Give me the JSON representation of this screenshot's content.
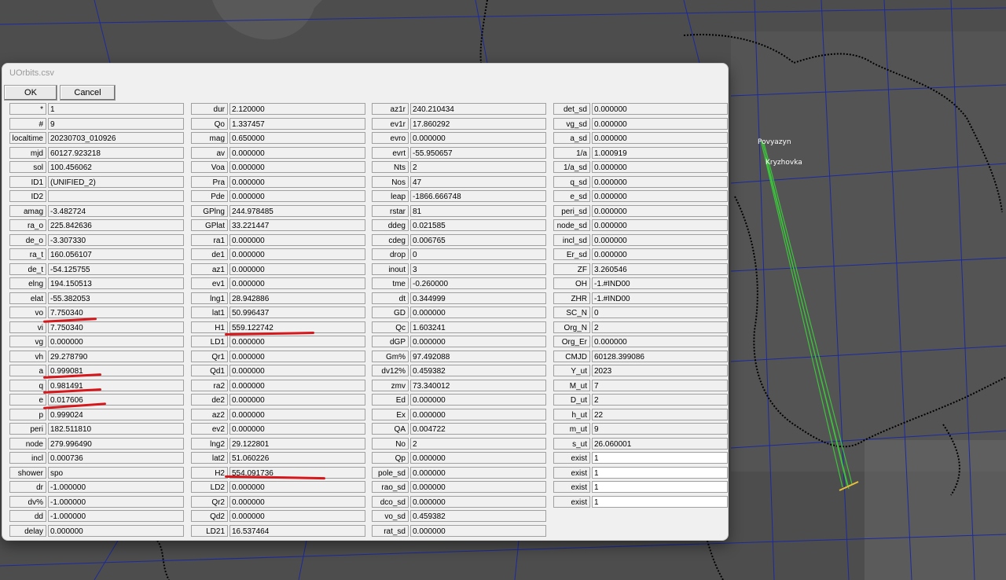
{
  "window": {
    "title": "UOrbits.csv"
  },
  "buttons": {
    "ok": "OK",
    "cancel": "Cancel"
  },
  "map": {
    "stations": [
      {
        "name": "Povyazyn"
      },
      {
        "name": "Kryzhovka"
      }
    ]
  },
  "columns": [
    [
      {
        "label": "*",
        "value": "1"
      },
      {
        "label": "#",
        "value": "9"
      },
      {
        "label": "localtime",
        "value": "20230703_010926"
      },
      {
        "label": "mjd",
        "value": "60127.923218"
      },
      {
        "label": "sol",
        "value": "100.456062"
      },
      {
        "label": "ID1",
        "value": "(UNIFIED_2)"
      },
      {
        "label": "ID2",
        "value": ""
      },
      {
        "label": "amag",
        "value": "-3.482724"
      },
      {
        "label": "ra_o",
        "value": "225.842636"
      },
      {
        "label": "de_o",
        "value": "-3.307330"
      },
      {
        "label": "ra_t",
        "value": "160.056107"
      },
      {
        "label": "de_t",
        "value": "-54.125755"
      },
      {
        "label": "elng",
        "value": "194.150513"
      },
      {
        "label": "elat",
        "value": "-55.382053"
      },
      {
        "label": "vo",
        "value": "7.750340"
      },
      {
        "label": "vi",
        "value": "7.750340"
      },
      {
        "label": "vg",
        "value": "0.000000"
      },
      {
        "label": "vh",
        "value": "29.278790"
      },
      {
        "label": "a",
        "value": "0.999081"
      },
      {
        "label": "q",
        "value": "0.981491"
      },
      {
        "label": "e",
        "value": "0.017606"
      },
      {
        "label": "p",
        "value": "0.999024"
      },
      {
        "label": "peri",
        "value": "182.511810"
      },
      {
        "label": "node",
        "value": "279.996490"
      },
      {
        "label": "incl",
        "value": "0.000736"
      },
      {
        "label": "shower",
        "value": "spo"
      },
      {
        "label": "dr",
        "value": "-1.000000"
      },
      {
        "label": "dv%",
        "value": "-1.000000"
      },
      {
        "label": "dd",
        "value": "-1.000000"
      },
      {
        "label": "delay",
        "value": "0.000000"
      }
    ],
    [
      {
        "label": "dur",
        "value": "2.120000"
      },
      {
        "label": "Qo",
        "value": "1.337457"
      },
      {
        "label": "mag",
        "value": "0.650000"
      },
      {
        "label": "av",
        "value": "0.000000"
      },
      {
        "label": "Voa",
        "value": "0.000000"
      },
      {
        "label": "Pra",
        "value": "0.000000"
      },
      {
        "label": "Pde",
        "value": "0.000000"
      },
      {
        "label": "GPlng",
        "value": "244.978485"
      },
      {
        "label": "GPlat",
        "value": "33.221447"
      },
      {
        "label": "ra1",
        "value": "0.000000"
      },
      {
        "label": "de1",
        "value": "0.000000"
      },
      {
        "label": "az1",
        "value": "0.000000"
      },
      {
        "label": "ev1",
        "value": "0.000000"
      },
      {
        "label": "lng1",
        "value": "28.942886"
      },
      {
        "label": "lat1",
        "value": "50.996437"
      },
      {
        "label": "H1",
        "value": "559.122742"
      },
      {
        "label": "LD1",
        "value": "0.000000"
      },
      {
        "label": "Qr1",
        "value": "0.000000"
      },
      {
        "label": "Qd1",
        "value": "0.000000"
      },
      {
        "label": "ra2",
        "value": "0.000000"
      },
      {
        "label": "de2",
        "value": "0.000000"
      },
      {
        "label": "az2",
        "value": "0.000000"
      },
      {
        "label": "ev2",
        "value": "0.000000"
      },
      {
        "label": "lng2",
        "value": "29.122801"
      },
      {
        "label": "lat2",
        "value": "51.060226"
      },
      {
        "label": "H2",
        "value": "554.091736"
      },
      {
        "label": "LD2",
        "value": "0.000000"
      },
      {
        "label": "Qr2",
        "value": "0.000000"
      },
      {
        "label": "Qd2",
        "value": "0.000000"
      },
      {
        "label": "LD21",
        "value": "16.537464"
      }
    ],
    [
      {
        "label": "az1r",
        "value": "240.210434"
      },
      {
        "label": "ev1r",
        "value": "17.860292"
      },
      {
        "label": "evro",
        "value": "0.000000"
      },
      {
        "label": "evrt",
        "value": "-55.950657"
      },
      {
        "label": "Nts",
        "value": "2"
      },
      {
        "label": "Nos",
        "value": "47"
      },
      {
        "label": "leap",
        "value": "-1866.666748"
      },
      {
        "label": "rstar",
        "value": "81"
      },
      {
        "label": "ddeg",
        "value": "0.021585"
      },
      {
        "label": "cdeg",
        "value": "0.006765"
      },
      {
        "label": "drop",
        "value": "0"
      },
      {
        "label": "inout",
        "value": "3"
      },
      {
        "label": "tme",
        "value": "-0.260000"
      },
      {
        "label": "dt",
        "value": "0.344999"
      },
      {
        "label": "GD",
        "value": "0.000000"
      },
      {
        "label": "Qc",
        "value": "1.603241"
      },
      {
        "label": "dGP",
        "value": "0.000000"
      },
      {
        "label": "Gm%",
        "value": "97.492088"
      },
      {
        "label": "dv12%",
        "value": "0.459382"
      },
      {
        "label": "zmv",
        "value": "73.340012"
      },
      {
        "label": "Ed",
        "value": "0.000000"
      },
      {
        "label": "Ex",
        "value": "0.000000"
      },
      {
        "label": "QA",
        "value": "0.004722"
      },
      {
        "label": "No",
        "value": "2"
      },
      {
        "label": "Qp",
        "value": "0.000000"
      },
      {
        "label": "pole_sd",
        "value": "0.000000"
      },
      {
        "label": "rao_sd",
        "value": "0.000000"
      },
      {
        "label": "dco_sd",
        "value": "0.000000"
      },
      {
        "label": "vo_sd",
        "value": "0.459382"
      },
      {
        "label": "rat_sd",
        "value": "0.000000"
      }
    ],
    [
      {
        "label": "det_sd",
        "value": "0.000000"
      },
      {
        "label": "vg_sd",
        "value": "0.000000"
      },
      {
        "label": "a_sd",
        "value": "0.000000"
      },
      {
        "label": "1/a",
        "value": "1.000919"
      },
      {
        "label": "1/a_sd",
        "value": "0.000000"
      },
      {
        "label": "q_sd",
        "value": "0.000000"
      },
      {
        "label": "e_sd",
        "value": "0.000000"
      },
      {
        "label": "peri_sd",
        "value": "0.000000"
      },
      {
        "label": "node_sd",
        "value": "0.000000"
      },
      {
        "label": "incl_sd",
        "value": "0.000000"
      },
      {
        "label": "Er_sd",
        "value": "0.000000"
      },
      {
        "label": "ZF",
        "value": "3.260546"
      },
      {
        "label": "OH",
        "value": "-1.#IND00"
      },
      {
        "label": "ZHR",
        "value": "-1.#IND00"
      },
      {
        "label": "SC_N",
        "value": "0"
      },
      {
        "label": "Org_N",
        "value": "2"
      },
      {
        "label": "Org_Er",
        "value": "0.000000"
      },
      {
        "label": "CMJD",
        "value": "60128.399086"
      },
      {
        "label": "Y_ut",
        "value": "2023"
      },
      {
        "label": "M_ut",
        "value": "7"
      },
      {
        "label": "D_ut",
        "value": "2"
      },
      {
        "label": "h_ut",
        "value": "22"
      },
      {
        "label": "m_ut",
        "value": "9"
      },
      {
        "label": "s_ut",
        "value": "26.060001"
      },
      {
        "label": "exist",
        "value": "1",
        "editable": true
      },
      {
        "label": "exist",
        "value": "1",
        "editable": true
      },
      {
        "label": "exist",
        "value": "1",
        "editable": true
      },
      {
        "label": "exist",
        "value": "1",
        "editable": true
      }
    ]
  ],
  "colors": {
    "map_background": "#4b4b4b",
    "grid_lines": "#1c2a9c",
    "borders": "#000000",
    "trajectory": "#3cc43c",
    "annotation_underline": "#d6171b",
    "dialog_background": "#f0f0f0"
  }
}
